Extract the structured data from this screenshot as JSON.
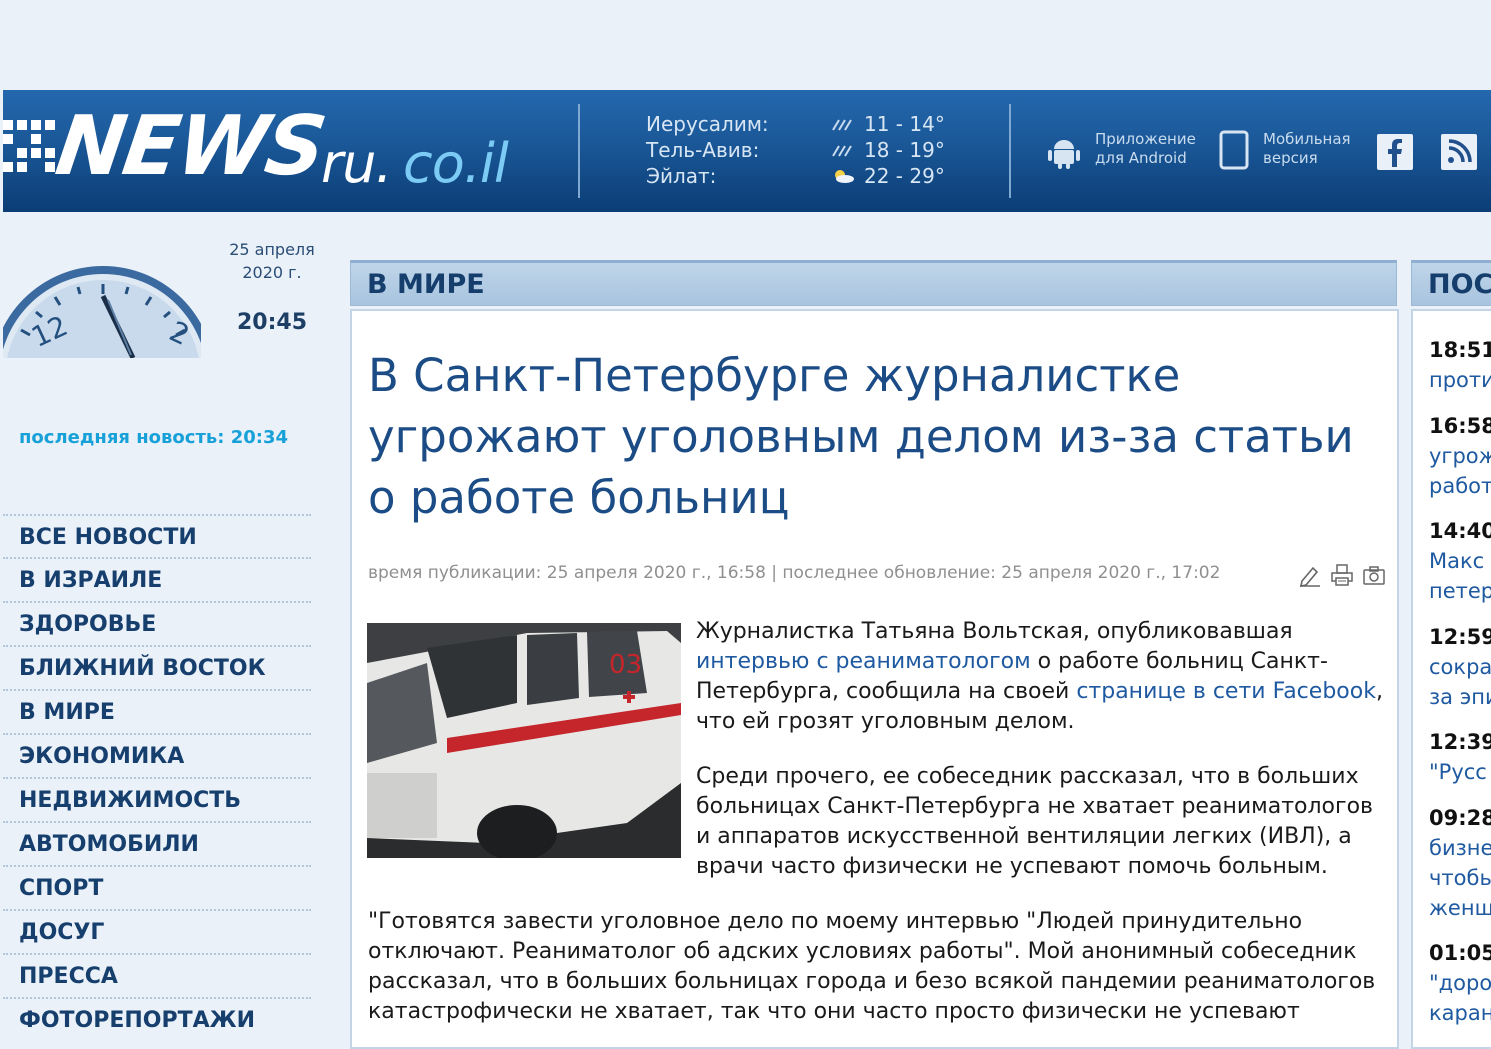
{
  "header": {
    "logo": {
      "news": "NEWS",
      "ru": "ru.",
      "domain": "co.il"
    },
    "weather": [
      {
        "city": "Иерусалим:",
        "temp": "11 - 14°",
        "icon": "rain-icon"
      },
      {
        "city": "Тель-Авив:",
        "temp": "18 - 19°",
        "icon": "rain-icon"
      },
      {
        "city": "Эйлат:",
        "temp": "22 - 29°",
        "icon": "sun-cloud-icon"
      }
    ],
    "android": {
      "line1": "Приложение",
      "line2": "для Android"
    },
    "mobile": {
      "line1": "Мобильная",
      "line2": "версия"
    }
  },
  "sidebar": {
    "date_line1": "25 апреля",
    "date_line2": "2020 г.",
    "time": "20:45",
    "last_news": "последняя новость: 20:34",
    "menu": [
      "ВСЕ НОВОСТИ",
      "В ИЗРАИЛЕ",
      "ЗДОРОВЬЕ",
      "БЛИЖНИЙ ВОСТОК",
      "В МИРЕ",
      "ЭКОНОМИКА",
      "НЕДВИЖИМОСТЬ",
      "АВТОМОБИЛИ",
      "СПОРТ",
      "ДОСУГ",
      "ПРЕССА",
      "ФОТОРЕПОРТАЖИ"
    ]
  },
  "main": {
    "section": "В МИРЕ",
    "title": "В Санкт-Петербурге журналистке угрожают уголовным делом из-за статьи о работе больниц",
    "meta": "время публикации: 25 апреля 2020 г., 16:58 | последнее обновление: 25 апреля 2020 г., 17:02",
    "p1": {
      "a": "Журналистка Татьяна Вольтская, опубликовавшая ",
      "link1": "интервью с реаниматологом",
      "b": " о работе больниц Санкт-Петербурга, сообщила на своей ",
      "link2": "странице в сети Facebook",
      "c": ", что ей грозят уголовным делом."
    },
    "p2": "Среди прочего, ее собеседник рассказал, что в больших больницах Санкт-Петербурга не хватает реаниматологов и аппаратов искусственной вентиляции легких (ИВЛ), а врачи часто физически не успевают помочь больным.",
    "p3": "\"Готовятся завести уголовное дело по моему интервью \"Людей принудительно отключают. Реаниматолог об адских условиях работы\". Мой анонимный собеседник рассказал, что в больших больницах города и безо всякой пандемии реаниматологов катастрофически не хватает, так что они часто просто физически не успевают",
    "photo_label": "03"
  },
  "right": {
    "head": "ПОСЛ",
    "items": [
      {
        "time": "18:51",
        "lines": [
          "проти"
        ]
      },
      {
        "time": "16:58",
        "lines": [
          "угрож",
          "работ"
        ]
      },
      {
        "time": "14:40",
        "lines": [
          "Макс",
          "петер"
        ]
      },
      {
        "time": "12:59",
        "lines": [
          "сокра",
          "за эпи"
        ]
      },
      {
        "time": "12:39",
        "lines": [
          "\"Русс"
        ]
      },
      {
        "time": "09:28",
        "lines": [
          "бизне",
          "чтобь",
          "женщ"
        ]
      },
      {
        "time": "01:05",
        "lines": [
          "\"доро",
          "каран"
        ]
      }
    ]
  },
  "colors": {
    "header": "#1a5797",
    "link": "#1f5aa1",
    "title": "#1c4c86",
    "accent": "#18a1d9",
    "menu": "#173f6e"
  }
}
